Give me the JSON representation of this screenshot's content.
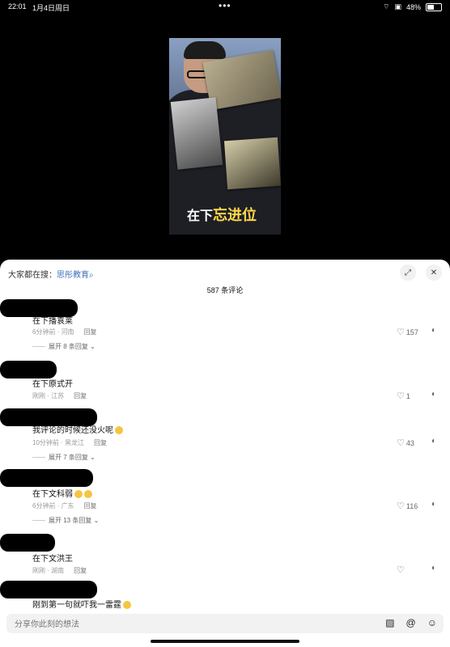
{
  "status": {
    "time": "22:01",
    "date": "1月4日周日",
    "battery": "48%",
    "battery_level": 0.48
  },
  "video": {
    "caption_prefix": "在下",
    "caption_highlight": "忘进位"
  },
  "panel": {
    "search_prefix": "大家都在搜：",
    "search_term": "思彤教育",
    "search_icon": "magnifier-icon",
    "comment_count": "587 条评论"
  },
  "comments": [
    {
      "text": "在下播袁莱",
      "time": "6分钟前",
      "location": "河南",
      "reply": "回复",
      "likes": "157",
      "expand": "展开 8 条回复"
    },
    {
      "text": "在下原式开",
      "time": "刚刚",
      "location": "江苏",
      "reply": "回复",
      "likes": "1",
      "expand": ""
    },
    {
      "text": "我评论的时候还没火呢",
      "time": "10分钟前",
      "location": "黑龙江",
      "reply": "回复",
      "likes": "43",
      "expand": "展开 7 条回复"
    },
    {
      "text": "在下文科弱",
      "time": "6分钟前",
      "location": "广东",
      "reply": "回复",
      "likes": "116",
      "expand": "展开 13 条回复"
    },
    {
      "text": "在下文洪王",
      "time": "刚刚",
      "location": "湖南",
      "reply": "回复",
      "likes": "",
      "expand": ""
    },
    {
      "text": "刚到第一句就吓我一雷霆",
      "time": "",
      "location": "",
      "reply": "",
      "likes": "",
      "expand": ""
    }
  ],
  "input": {
    "placeholder": "分享你此刻的想法"
  }
}
